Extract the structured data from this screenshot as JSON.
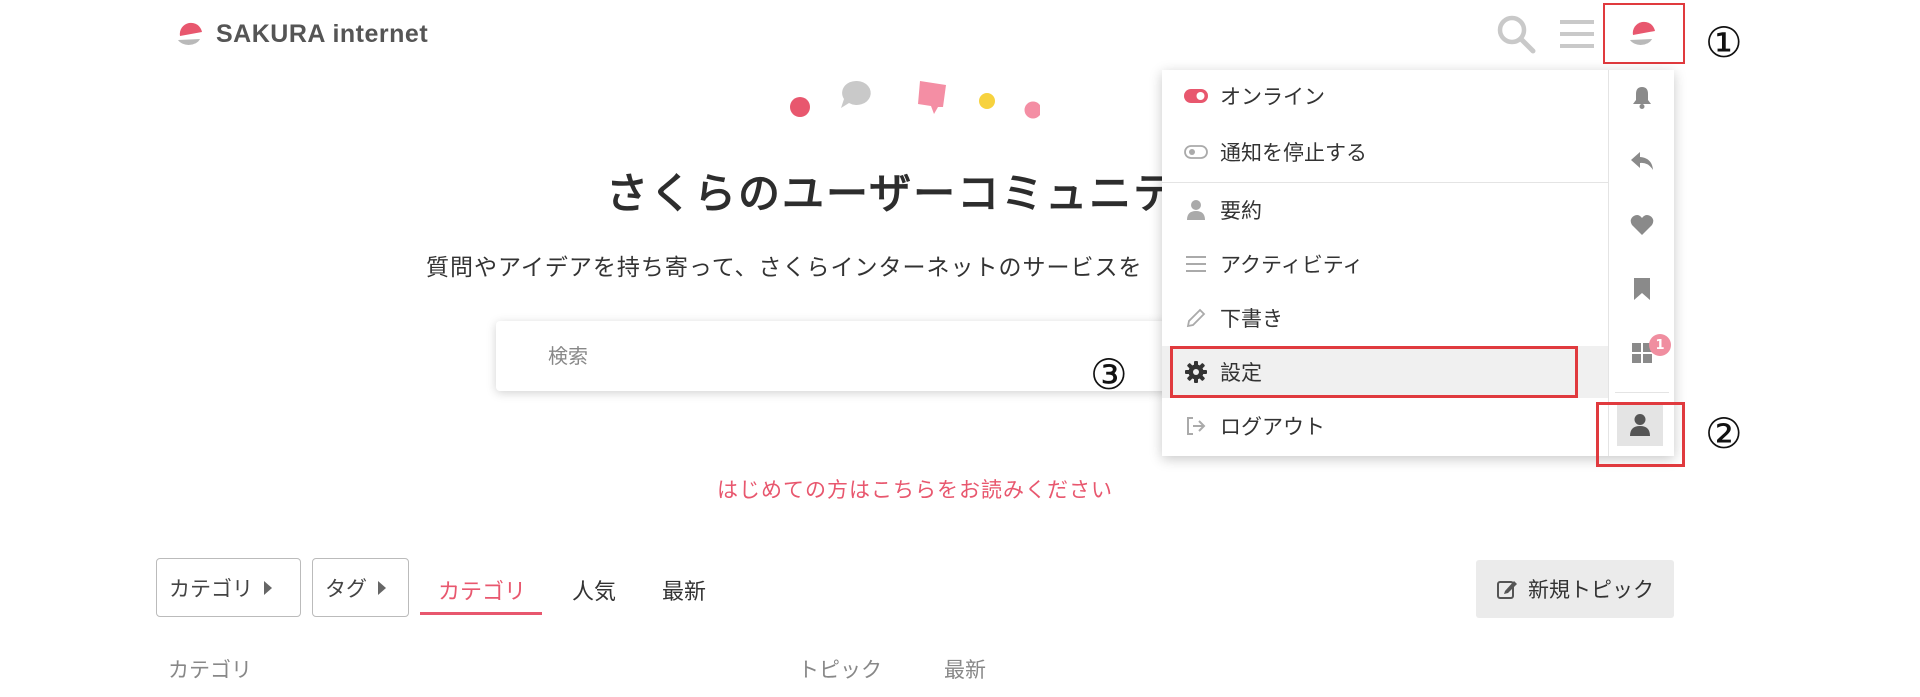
{
  "header": {
    "logo_text": "SAKURA internet",
    "brand_color": "#e8576e",
    "icons": [
      "search-icon",
      "hamburger-icon",
      "sakura-avatar-icon"
    ]
  },
  "callouts": {
    "one": "①",
    "two": "②",
    "three": "③",
    "outline_color": "#e03a3e"
  },
  "hero": {
    "title": "さくらのユーザーコミュニテ",
    "subtitle": "質問やアイデアを持ち寄って、さくらインターネットのサービスを"
  },
  "search": {
    "placeholder": "検索"
  },
  "welcome_link": "はじめての方はこちらをお読みください",
  "nav": {
    "category_dropdown": "カテゴリ",
    "tag_dropdown": "タグ",
    "tabs": [
      {
        "label": "カテゴリ",
        "active": true
      },
      {
        "label": "人気",
        "active": false
      },
      {
        "label": "最新",
        "active": false
      }
    ],
    "new_topic_label": "新規トピック"
  },
  "table_headers": {
    "category": "カテゴリ",
    "topics": "トピック",
    "latest": "最新"
  },
  "user_menu": {
    "items": [
      {
        "label": "オンライン",
        "icon": "toggle-on-icon"
      },
      {
        "label": "通知を停止する",
        "icon": "toggle-off-icon"
      },
      {
        "label": "要約",
        "icon": "user-icon"
      },
      {
        "label": "アクティビティ",
        "icon": "list-icon"
      },
      {
        "label": "下書き",
        "icon": "pencil-icon"
      },
      {
        "label": "設定",
        "icon": "gear-icon"
      },
      {
        "label": "ログアウト",
        "icon": "sign-out-icon"
      }
    ],
    "rail": [
      "bell-icon",
      "reply-icon",
      "heart-icon",
      "bookmark-icon",
      "widgets-icon",
      "profile-icon"
    ],
    "badge_count": "1"
  }
}
